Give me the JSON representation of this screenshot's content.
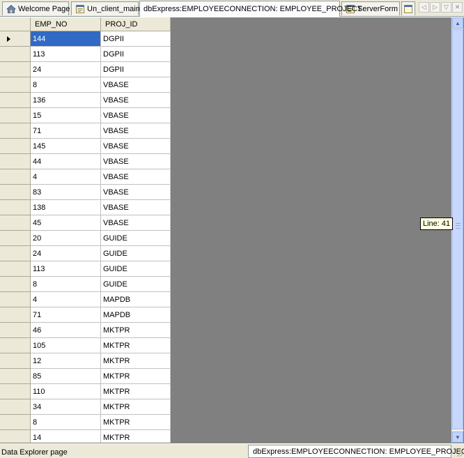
{
  "tabs": [
    {
      "label": "Welcome Page",
      "icon": "home-icon",
      "active": false
    },
    {
      "label": "Un_client_main",
      "icon": "form-icon",
      "active": false
    },
    {
      "label": "dbExpress:EMPLOYEECONNECTION: EMPLOYEE_PROJECT",
      "icon": "",
      "active": true
    },
    {
      "label": "ServerForm",
      "icon": "form-icon",
      "active": false
    },
    {
      "label": "",
      "icon": "form-icon",
      "active": false
    }
  ],
  "nav_buttons": [
    "scroll-left",
    "scroll-right",
    "dropdown",
    "close"
  ],
  "grid": {
    "columns": [
      "EMP_NO",
      "PROJ_ID"
    ],
    "rows": [
      [
        "144",
        "DGPII"
      ],
      [
        "113",
        "DGPII"
      ],
      [
        "24",
        "DGPII"
      ],
      [
        "8",
        "VBASE"
      ],
      [
        "136",
        "VBASE"
      ],
      [
        "15",
        "VBASE"
      ],
      [
        "71",
        "VBASE"
      ],
      [
        "145",
        "VBASE"
      ],
      [
        "44",
        "VBASE"
      ],
      [
        "4",
        "VBASE"
      ],
      [
        "83",
        "VBASE"
      ],
      [
        "138",
        "VBASE"
      ],
      [
        "45",
        "VBASE"
      ],
      [
        "20",
        "GUIDE"
      ],
      [
        "24",
        "GUIDE"
      ],
      [
        "113",
        "GUIDE"
      ],
      [
        "8",
        "GUIDE"
      ],
      [
        "4",
        "MAPDB"
      ],
      [
        "71",
        "MAPDB"
      ],
      [
        "46",
        "MKTPR"
      ],
      [
        "105",
        "MKTPR"
      ],
      [
        "12",
        "MKTPR"
      ],
      [
        "85",
        "MKTPR"
      ],
      [
        "110",
        "MKTPR"
      ],
      [
        "34",
        "MKTPR"
      ],
      [
        "8",
        "MKTPR"
      ],
      [
        "14",
        "MKTPR"
      ]
    ],
    "selected_row": 0
  },
  "tooltip": "Line: 41",
  "status": {
    "left_label": "Data Explorer page",
    "right_tab": "dbExpress:EMPLOYEECONNECTION: EMPLOYEE_PROJECT"
  }
}
